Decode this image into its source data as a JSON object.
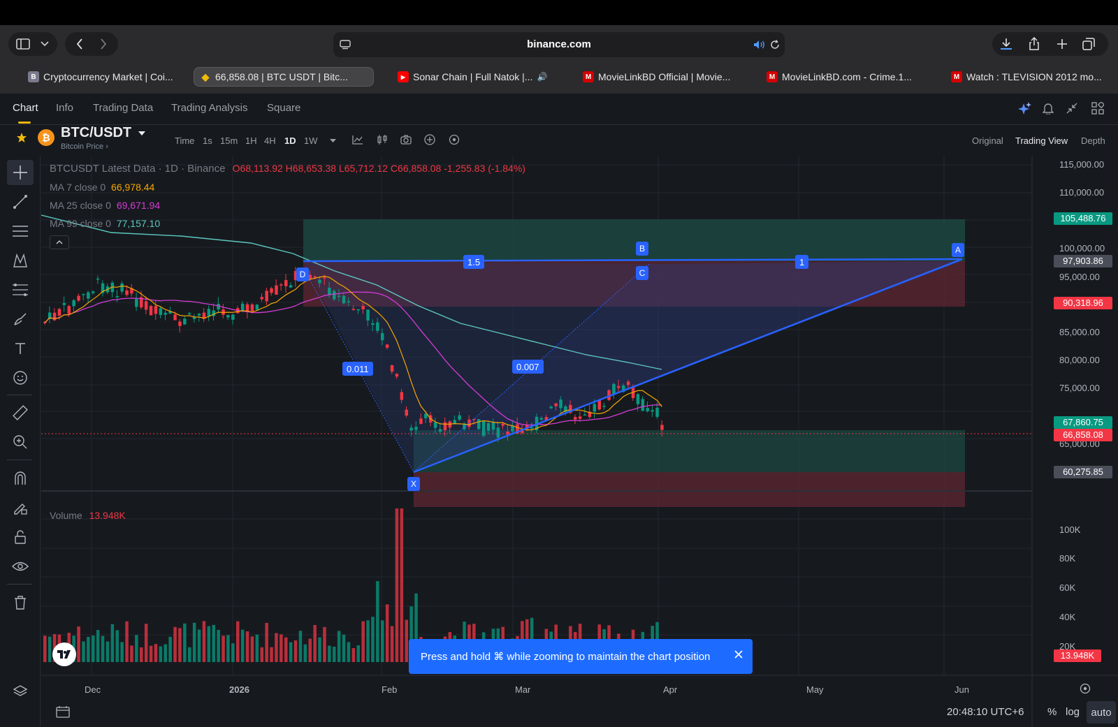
{
  "browser": {
    "url": "binance.com",
    "tabs": [
      {
        "label": "Cryptocurrency Market | Coi...",
        "favicon": "B",
        "favicon_color": "#7a7a8c"
      },
      {
        "label": "66,858.08 | BTC USDT | Bitc...",
        "favicon": "◆",
        "favicon_color": "#f0b90b",
        "active": true
      },
      {
        "label": "Sonar Chain | Full Natok |...",
        "favicon": "▶",
        "favicon_color": "#ff0000",
        "audio": "🔊"
      },
      {
        "label": "MovieLinkBD Official | Movie...",
        "favicon": "M",
        "favicon_color": "#d50000"
      },
      {
        "label": "MovieLinkBD.com - Crime.1...",
        "favicon": "M",
        "favicon_color": "#d50000"
      },
      {
        "label": "Watch : TLEVISION 2012 mo...",
        "favicon": "M",
        "favicon_color": "#d50000"
      }
    ]
  },
  "nav": {
    "tabs": [
      "Chart",
      "Info",
      "Trading Data",
      "Trading Analysis",
      "Square"
    ],
    "active": "Chart"
  },
  "symbol": {
    "pair": "BTC/USDT",
    "subtitle": "Bitcoin Price ›",
    "intervals": [
      "Time",
      "1s",
      "15m",
      "1H",
      "4H",
      "1D",
      "1W"
    ],
    "active_interval": "1D",
    "views": [
      "Original",
      "Trading View",
      "Depth"
    ],
    "active_view": "Trading View"
  },
  "legend": {
    "title": "BTCUSDT Latest Data · 1D · Binance",
    "ohlc": "O68,113.92 H68,653.38 L65,712.12 C66,858.08 -1,255.83 (-1.84%)",
    "ma7_label": "MA 7 close 0",
    "ma7_value": "66,978.44",
    "ma25_label": "MA 25 close 0",
    "ma25_value": "69,671.94",
    "ma99_label": "MA 99 close 0",
    "ma99_value": "77,157.10",
    "volume_label": "Volume",
    "volume_value": "13.948K"
  },
  "price_axis": [
    "115,000.00",
    "110,000.00",
    "100,000.00",
    "95,000.00",
    "85,000.00",
    "80,000.00",
    "75,000.00",
    "65,000.00"
  ],
  "price_tags": [
    {
      "value": "105,488.76",
      "color": "#089981"
    },
    {
      "value": "97,903.86",
      "color": "#4a4e59"
    },
    {
      "value": "90,318.96",
      "color": "#f23645"
    },
    {
      "value": "67,860.75",
      "color": "#089981"
    },
    {
      "value": "66,858.08",
      "color": "#f23645"
    },
    {
      "value": "60,275.85",
      "color": "#4a4e59"
    }
  ],
  "volume_axis": [
    "100K",
    "80K",
    "60K",
    "40K",
    "20K"
  ],
  "volume_tag": "13.948K",
  "time_axis": [
    "Dec",
    "2026",
    "Feb",
    "Mar",
    "Apr",
    "May",
    "Jun"
  ],
  "pattern": {
    "points": [
      "X",
      "A",
      "B",
      "C",
      "D"
    ],
    "ratios": [
      "1.5",
      "1",
      "0.011",
      "0.007"
    ]
  },
  "toast": {
    "text": "Press and hold ⌘ while zooming to maintain the chart position"
  },
  "footer": {
    "clock": "20:48:10 UTC+6",
    "percent": "%",
    "log": "log",
    "auto": "auto"
  },
  "colors": {
    "up": "#089981",
    "down": "#f23645",
    "ma7": "#f7a600",
    "ma25": "#d63bd6",
    "ma99": "#5cc8c0",
    "pattern": "#2962ff",
    "accent": "#f0b90b"
  }
}
